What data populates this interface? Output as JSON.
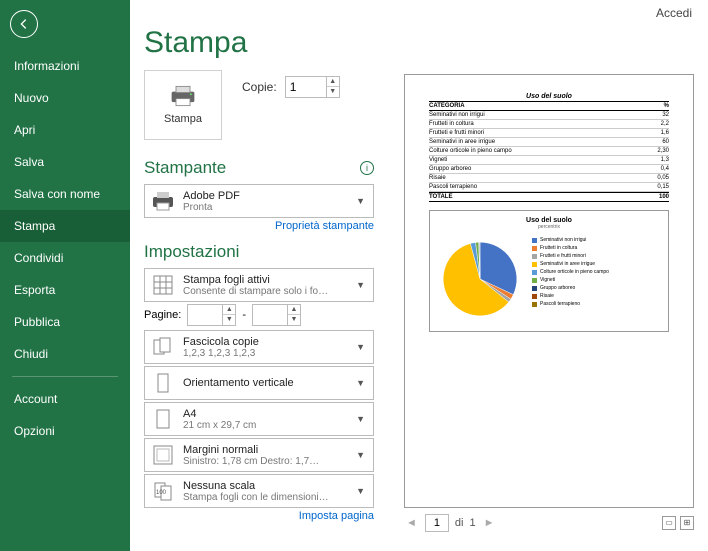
{
  "header": {
    "accedi": "Accedi"
  },
  "title": "Stampa",
  "sidebar": {
    "items": [
      "Informazioni",
      "Nuovo",
      "Apri",
      "Salva",
      "Salva con nome",
      "Stampa",
      "Condividi",
      "Esporta",
      "Pubblica",
      "Chiudi"
    ],
    "account": "Account",
    "options": "Opzioni",
    "active": "Stampa"
  },
  "print": {
    "button": "Stampa",
    "copies_label": "Copie:",
    "copies_value": "1"
  },
  "printer_section": {
    "heading": "Stampante",
    "name": "Adobe PDF",
    "status": "Pronta",
    "properties_link": "Proprietà stampante"
  },
  "settings_section": {
    "heading": "Impostazioni",
    "active_sheets": {
      "l1": "Stampa fogli attivi",
      "l2": "Consente di stampare solo i fo…"
    },
    "pages_label": "Pagine:",
    "pages_sep": "-",
    "collate": {
      "l1": "Fascicola copie",
      "l2": "1,2,3    1,2,3    1,2,3"
    },
    "orientation": {
      "l1": "Orientamento verticale"
    },
    "paper": {
      "l1": "A4",
      "l2": "21 cm x 29,7 cm"
    },
    "margins": {
      "l1": "Margini normali",
      "l2": "Sinistro:  1,78 cm    Destro:  1,7…"
    },
    "scaling": {
      "l1": "Nessuna scala",
      "l2": "Stampa fogli con le dimensioni…"
    },
    "page_setup_link": "Imposta pagina"
  },
  "pager": {
    "current": "1",
    "of_label": "di",
    "total": "1"
  },
  "chart_data": {
    "type": "pie",
    "title": "Uso del suolo",
    "subtitle": "percentrix",
    "table_title": "Uso del suolo",
    "col1": "CATEGORIA",
    "col2": "%",
    "total_label": "TOTALE",
    "total_value": "100",
    "rows": [
      {
        "label": "Seminativi non irrigui",
        "value": "32",
        "color": "#4472C4"
      },
      {
        "label": "Frutteti in coltura",
        "value": "2,2",
        "color": "#ED7D31"
      },
      {
        "label": "Frutteti e frutti minori",
        "value": "1,6",
        "color": "#A5A5A5"
      },
      {
        "label": "Seminativi in aree irrigue",
        "value": "60",
        "color": "#FFC000"
      },
      {
        "label": "Colture orticole in pieno campo",
        "value": "2,30",
        "color": "#5B9BD5"
      },
      {
        "label": "Vigneti",
        "value": "1,3",
        "color": "#70AD47"
      },
      {
        "label": "Gruppo arboreo",
        "value": "0,4",
        "color": "#264478"
      },
      {
        "label": "Risaie",
        "value": "0,05",
        "color": "#9E480E"
      },
      {
        "label": "Pascoli terrapieno",
        "value": "0,15",
        "color": "#997300"
      }
    ]
  }
}
